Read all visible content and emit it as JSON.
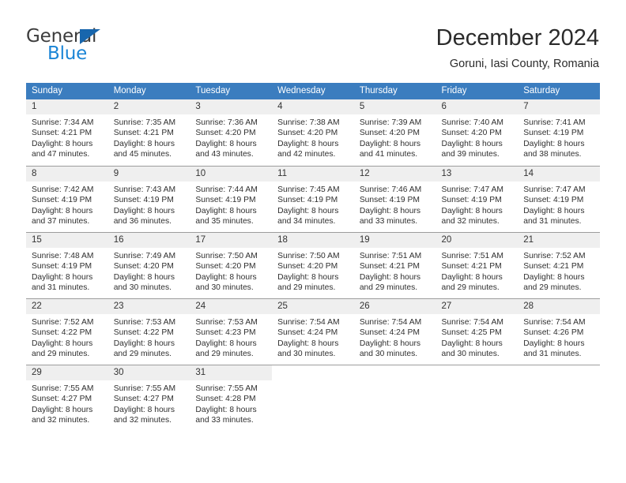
{
  "brand": {
    "name_part1": "General",
    "name_part2": "Blue",
    "triangle_color": "#1866ad",
    "blue_color": "#1b85d6",
    "gray_color": "#3c3c3c"
  },
  "header": {
    "title": "December 2024",
    "subtitle": "Goruni, Iasi County, Romania"
  },
  "theme": {
    "header_bg": "#3b7dbf",
    "header_text": "#ffffff",
    "daynum_bg": "#efefef",
    "grid_line": "#9d9d9d",
    "body_text": "#2f2f2f"
  },
  "calendar": {
    "weekday_headers": [
      "Sunday",
      "Monday",
      "Tuesday",
      "Wednesday",
      "Thursday",
      "Friday",
      "Saturday"
    ],
    "weeks": [
      [
        {
          "day": "1",
          "sunrise": "Sunrise: 7:34 AM",
          "sunset": "Sunset: 4:21 PM",
          "daylight1": "Daylight: 8 hours",
          "daylight2": "and 47 minutes."
        },
        {
          "day": "2",
          "sunrise": "Sunrise: 7:35 AM",
          "sunset": "Sunset: 4:21 PM",
          "daylight1": "Daylight: 8 hours",
          "daylight2": "and 45 minutes."
        },
        {
          "day": "3",
          "sunrise": "Sunrise: 7:36 AM",
          "sunset": "Sunset: 4:20 PM",
          "daylight1": "Daylight: 8 hours",
          "daylight2": "and 43 minutes."
        },
        {
          "day": "4",
          "sunrise": "Sunrise: 7:38 AM",
          "sunset": "Sunset: 4:20 PM",
          "daylight1": "Daylight: 8 hours",
          "daylight2": "and 42 minutes."
        },
        {
          "day": "5",
          "sunrise": "Sunrise: 7:39 AM",
          "sunset": "Sunset: 4:20 PM",
          "daylight1": "Daylight: 8 hours",
          "daylight2": "and 41 minutes."
        },
        {
          "day": "6",
          "sunrise": "Sunrise: 7:40 AM",
          "sunset": "Sunset: 4:20 PM",
          "daylight1": "Daylight: 8 hours",
          "daylight2": "and 39 minutes."
        },
        {
          "day": "7",
          "sunrise": "Sunrise: 7:41 AM",
          "sunset": "Sunset: 4:19 PM",
          "daylight1": "Daylight: 8 hours",
          "daylight2": "and 38 minutes."
        }
      ],
      [
        {
          "day": "8",
          "sunrise": "Sunrise: 7:42 AM",
          "sunset": "Sunset: 4:19 PM",
          "daylight1": "Daylight: 8 hours",
          "daylight2": "and 37 minutes."
        },
        {
          "day": "9",
          "sunrise": "Sunrise: 7:43 AM",
          "sunset": "Sunset: 4:19 PM",
          "daylight1": "Daylight: 8 hours",
          "daylight2": "and 36 minutes."
        },
        {
          "day": "10",
          "sunrise": "Sunrise: 7:44 AM",
          "sunset": "Sunset: 4:19 PM",
          "daylight1": "Daylight: 8 hours",
          "daylight2": "and 35 minutes."
        },
        {
          "day": "11",
          "sunrise": "Sunrise: 7:45 AM",
          "sunset": "Sunset: 4:19 PM",
          "daylight1": "Daylight: 8 hours",
          "daylight2": "and 34 minutes."
        },
        {
          "day": "12",
          "sunrise": "Sunrise: 7:46 AM",
          "sunset": "Sunset: 4:19 PM",
          "daylight1": "Daylight: 8 hours",
          "daylight2": "and 33 minutes."
        },
        {
          "day": "13",
          "sunrise": "Sunrise: 7:47 AM",
          "sunset": "Sunset: 4:19 PM",
          "daylight1": "Daylight: 8 hours",
          "daylight2": "and 32 minutes."
        },
        {
          "day": "14",
          "sunrise": "Sunrise: 7:47 AM",
          "sunset": "Sunset: 4:19 PM",
          "daylight1": "Daylight: 8 hours",
          "daylight2": "and 31 minutes."
        }
      ],
      [
        {
          "day": "15",
          "sunrise": "Sunrise: 7:48 AM",
          "sunset": "Sunset: 4:19 PM",
          "daylight1": "Daylight: 8 hours",
          "daylight2": "and 31 minutes."
        },
        {
          "day": "16",
          "sunrise": "Sunrise: 7:49 AM",
          "sunset": "Sunset: 4:20 PM",
          "daylight1": "Daylight: 8 hours",
          "daylight2": "and 30 minutes."
        },
        {
          "day": "17",
          "sunrise": "Sunrise: 7:50 AM",
          "sunset": "Sunset: 4:20 PM",
          "daylight1": "Daylight: 8 hours",
          "daylight2": "and 30 minutes."
        },
        {
          "day": "18",
          "sunrise": "Sunrise: 7:50 AM",
          "sunset": "Sunset: 4:20 PM",
          "daylight1": "Daylight: 8 hours",
          "daylight2": "and 29 minutes."
        },
        {
          "day": "19",
          "sunrise": "Sunrise: 7:51 AM",
          "sunset": "Sunset: 4:21 PM",
          "daylight1": "Daylight: 8 hours",
          "daylight2": "and 29 minutes."
        },
        {
          "day": "20",
          "sunrise": "Sunrise: 7:51 AM",
          "sunset": "Sunset: 4:21 PM",
          "daylight1": "Daylight: 8 hours",
          "daylight2": "and 29 minutes."
        },
        {
          "day": "21",
          "sunrise": "Sunrise: 7:52 AM",
          "sunset": "Sunset: 4:21 PM",
          "daylight1": "Daylight: 8 hours",
          "daylight2": "and 29 minutes."
        }
      ],
      [
        {
          "day": "22",
          "sunrise": "Sunrise: 7:52 AM",
          "sunset": "Sunset: 4:22 PM",
          "daylight1": "Daylight: 8 hours",
          "daylight2": "and 29 minutes."
        },
        {
          "day": "23",
          "sunrise": "Sunrise: 7:53 AM",
          "sunset": "Sunset: 4:22 PM",
          "daylight1": "Daylight: 8 hours",
          "daylight2": "and 29 minutes."
        },
        {
          "day": "24",
          "sunrise": "Sunrise: 7:53 AM",
          "sunset": "Sunset: 4:23 PM",
          "daylight1": "Daylight: 8 hours",
          "daylight2": "and 29 minutes."
        },
        {
          "day": "25",
          "sunrise": "Sunrise: 7:54 AM",
          "sunset": "Sunset: 4:24 PM",
          "daylight1": "Daylight: 8 hours",
          "daylight2": "and 30 minutes."
        },
        {
          "day": "26",
          "sunrise": "Sunrise: 7:54 AM",
          "sunset": "Sunset: 4:24 PM",
          "daylight1": "Daylight: 8 hours",
          "daylight2": "and 30 minutes."
        },
        {
          "day": "27",
          "sunrise": "Sunrise: 7:54 AM",
          "sunset": "Sunset: 4:25 PM",
          "daylight1": "Daylight: 8 hours",
          "daylight2": "and 30 minutes."
        },
        {
          "day": "28",
          "sunrise": "Sunrise: 7:54 AM",
          "sunset": "Sunset: 4:26 PM",
          "daylight1": "Daylight: 8 hours",
          "daylight2": "and 31 minutes."
        }
      ],
      [
        {
          "day": "29",
          "sunrise": "Sunrise: 7:55 AM",
          "sunset": "Sunset: 4:27 PM",
          "daylight1": "Daylight: 8 hours",
          "daylight2": "and 32 minutes."
        },
        {
          "day": "30",
          "sunrise": "Sunrise: 7:55 AM",
          "sunset": "Sunset: 4:27 PM",
          "daylight1": "Daylight: 8 hours",
          "daylight2": "and 32 minutes."
        },
        {
          "day": "31",
          "sunrise": "Sunrise: 7:55 AM",
          "sunset": "Sunset: 4:28 PM",
          "daylight1": "Daylight: 8 hours",
          "daylight2": "and 33 minutes."
        },
        {
          "day": "",
          "sunrise": "",
          "sunset": "",
          "daylight1": "",
          "daylight2": ""
        },
        {
          "day": "",
          "sunrise": "",
          "sunset": "",
          "daylight1": "",
          "daylight2": ""
        },
        {
          "day": "",
          "sunrise": "",
          "sunset": "",
          "daylight1": "",
          "daylight2": ""
        },
        {
          "day": "",
          "sunrise": "",
          "sunset": "",
          "daylight1": "",
          "daylight2": ""
        }
      ]
    ]
  }
}
